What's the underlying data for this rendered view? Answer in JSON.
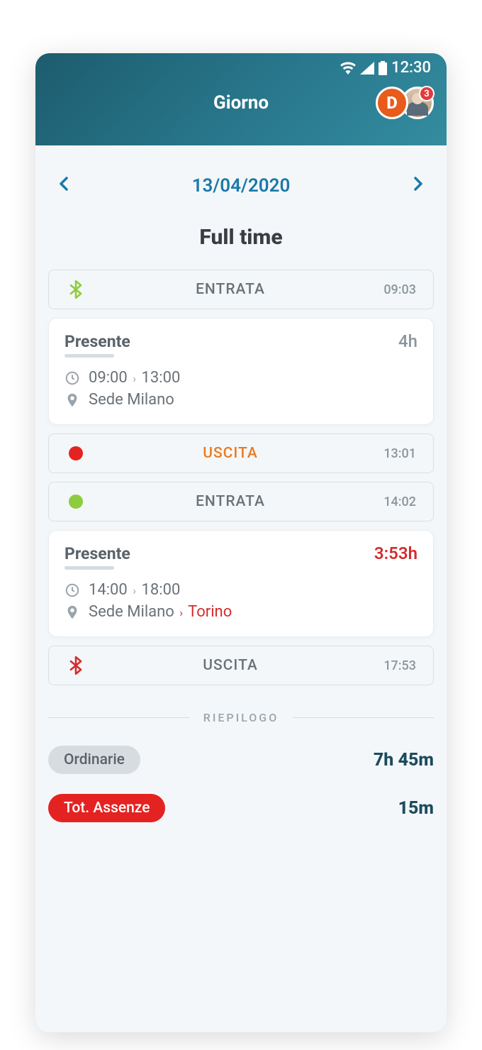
{
  "status_bar": {
    "time": "12:30"
  },
  "header": {
    "title": "Giorno",
    "badge_letter": "D",
    "notification_count": "3"
  },
  "date_nav": {
    "date": "13/04/2020"
  },
  "schedule_type": "Full time",
  "logs": [
    {
      "icon": "bluetooth",
      "icon_color": "#8dcc3f",
      "label": "ENTRATA",
      "label_color": "gray",
      "time": "09:03"
    }
  ],
  "block1": {
    "title": "Presente",
    "duration": "4h",
    "time_from": "09:00",
    "time_to": "13:00",
    "location": "Sede Milano"
  },
  "logs_mid": [
    {
      "icon": "dot",
      "icon_color": "red",
      "label": "USCITA",
      "label_color": "orange",
      "time": "13:01"
    },
    {
      "icon": "dot",
      "icon_color": "green",
      "label": "ENTRATA",
      "label_color": "gray",
      "time": "14:02"
    }
  ],
  "block2": {
    "title": "Presente",
    "duration": "3:53h",
    "duration_red": true,
    "time_from": "14:00",
    "time_to": "18:00",
    "location": "Sede Milano",
    "location_override": "Torino"
  },
  "logs_end": [
    {
      "icon": "bluetooth",
      "icon_color": "#d42c2c",
      "label": "USCITA",
      "label_color": "gray",
      "time": "17:53"
    }
  ],
  "summary": {
    "divider": "RIEPILOGO",
    "rows": [
      {
        "label": "Ordinarie",
        "pill": "gray",
        "value": "7h 45m"
      },
      {
        "label": "Tot. Assenze",
        "pill": "red",
        "value": "15m"
      }
    ]
  }
}
